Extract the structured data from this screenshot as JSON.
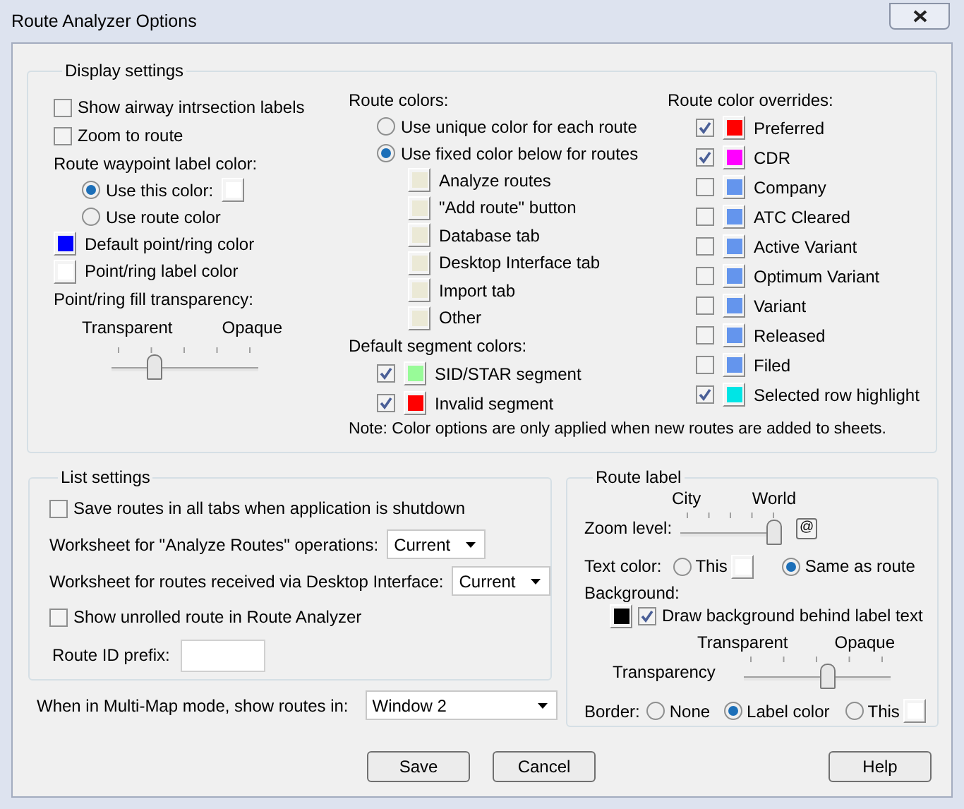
{
  "window": {
    "title": "Route Analyzer Options"
  },
  "display_settings": {
    "title": "Display settings",
    "columns": [
      {
        "items": [
          {
            "kind": "checkbox",
            "label": "Show airway intrsection labels",
            "checked": false
          },
          {
            "kind": "checkbox",
            "label": "Zoom to route",
            "checked": false
          },
          {
            "kind": "heading",
            "label": "Route waypoint label color:",
            "children": [
              {
                "kind": "radio",
                "label": "Use this color:",
                "selected": true,
                "color": "#ffffff"
              },
              {
                "kind": "radio",
                "label": "Use route color",
                "selected": false
              }
            ]
          },
          {
            "kind": "swatch",
            "label": "Default point/ring color",
            "color": "#0000ff"
          },
          {
            "kind": "swatch",
            "label": "Point/ring label color",
            "color": "#ffffff"
          },
          {
            "kind": "heading",
            "label": "Point/ring fill transparency:",
            "children": [
              {
                "kind": "slider",
                "min_label": "Transparent",
                "max_label": "Opaque",
                "level": 0.27
              }
            ]
          }
        ]
      },
      {
        "items": [
          {
            "kind": "heading",
            "label": "Route colors:",
            "children": [
              {
                "kind": "radio",
                "label": "Use unique color for each route",
                "selected": false
              },
              {
                "kind": "radio",
                "label": "Use fixed color below for routes",
                "selected": true,
                "children": [
                  {
                    "kind": "swatch",
                    "label": "Analyze routes",
                    "color": "#ebe9d6"
                  },
                  {
                    "kind": "swatch",
                    "label": "\"Add route\" button",
                    "color": "#ebe9d6"
                  },
                  {
                    "kind": "swatch",
                    "label": "Database tab",
                    "color": "#ebe9d6"
                  },
                  {
                    "kind": "swatch",
                    "label": "Desktop Interface tab",
                    "color": "#ebe9d6"
                  },
                  {
                    "kind": "swatch",
                    "label": "Import tab",
                    "color": "#ebe9d6"
                  },
                  {
                    "kind": "swatch",
                    "label": "Other",
                    "color": "#ebe9d6"
                  }
                ]
              }
            ]
          },
          {
            "kind": "heading",
            "label": "Default segment colors:",
            "children": [
              {
                "kind": "check_swatch",
                "label": "SID/STAR segment",
                "checked": true,
                "color": "#98fb98"
              },
              {
                "kind": "check_swatch",
                "label": "Invalid segment",
                "checked": true,
                "color": "#ff0000"
              }
            ]
          }
        ]
      },
      {
        "items": [
          {
            "kind": "heading",
            "label": "Route color overrides:",
            "children": [
              {
                "kind": "check_swatch",
                "label": "Preferred",
                "checked": true,
                "color": "#ff0000"
              },
              {
                "kind": "check_swatch",
                "label": "CDR",
                "checked": true,
                "color": "#ff00ff"
              },
              {
                "kind": "check_swatch",
                "label": "Company",
                "checked": false,
                "color": "#6495ed"
              },
              {
                "kind": "check_swatch",
                "label": "ATC Cleared",
                "checked": false,
                "color": "#6495ed"
              },
              {
                "kind": "check_swatch",
                "label": "Active Variant",
                "checked": false,
                "color": "#6495ed"
              },
              {
                "kind": "check_swatch",
                "label": "Optimum Variant",
                "checked": false,
                "color": "#6495ed"
              },
              {
                "kind": "check_swatch",
                "label": "Variant",
                "checked": false,
                "color": "#6495ed"
              },
              {
                "kind": "check_swatch",
                "label": "Released",
                "checked": false,
                "color": "#6495ed"
              },
              {
                "kind": "check_swatch",
                "label": "Filed",
                "checked": false,
                "color": "#6495ed"
              },
              {
                "kind": "check_swatch",
                "label": "Selected row highlight",
                "checked": true,
                "color": "#00e5e5"
              }
            ]
          }
        ]
      }
    ],
    "note": "Note: Color options are only applied when new routes are added to sheets."
  },
  "list_settings": {
    "title": "List settings",
    "items": [
      {
        "kind": "checkbox",
        "label": "Save routes in all tabs when application is shutdown",
        "checked": false
      },
      {
        "kind": "dropdown",
        "label": "Worksheet for \"Analyze Routes\" operations:",
        "value": "Current"
      },
      {
        "kind": "dropdown",
        "label": "Worksheet for routes received via Desktop Interface:",
        "value": "Current"
      },
      {
        "kind": "checkbox",
        "label": "Show unrolled route in Route Analyzer",
        "checked": false
      },
      {
        "kind": "field",
        "label": "Route ID prefix:"
      }
    ]
  },
  "multi_map": {
    "label": "When in Multi-Map mode, show routes in:",
    "value": "Window 2"
  },
  "route_label": {
    "title": "Route label",
    "zoom": {
      "label": "Zoom level:",
      "min_label": "City",
      "max_label": "World",
      "level": 1,
      "button": "@"
    },
    "text_color": {
      "label": "Text color:",
      "options": [
        {
          "label": "This",
          "selected": false,
          "color": "#ffffff"
        },
        {
          "label": "Same as route",
          "selected": true
        }
      ]
    },
    "background": {
      "label": "Background:",
      "color": "#000000",
      "checkbox": {
        "label": "Draw background behind label text",
        "checked": true
      }
    },
    "transparency": {
      "label": "Transparency",
      "min_label": "Transparent",
      "max_label": "Opaque",
      "level": 0.58
    },
    "border": {
      "label": "Border:",
      "options": [
        {
          "label": "None",
          "selected": false
        },
        {
          "label": "Label color",
          "selected": true
        },
        {
          "label": "This",
          "selected": false,
          "color": "#ffffff"
        }
      ]
    }
  },
  "buttons": [
    "Save",
    "Cancel",
    "Help"
  ]
}
